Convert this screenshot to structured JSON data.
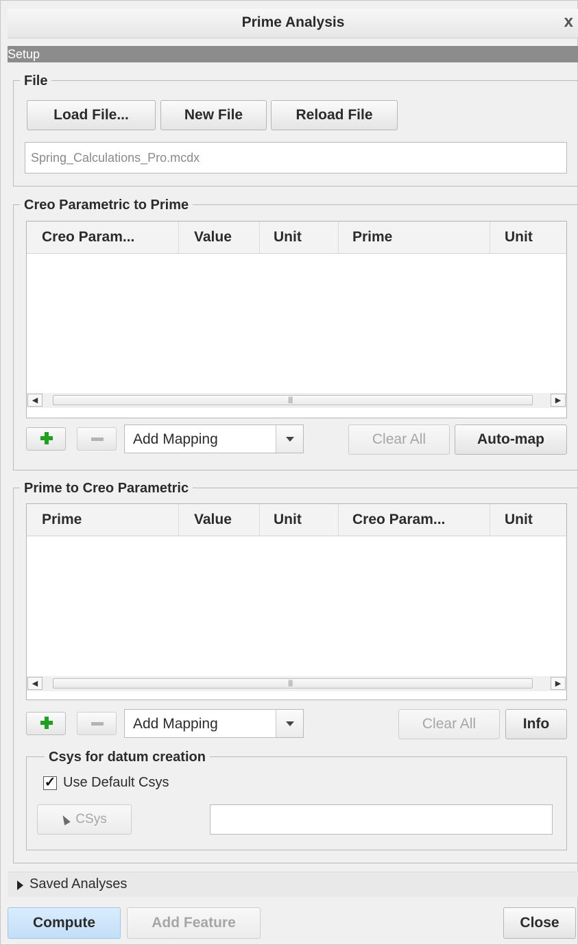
{
  "window": {
    "title": "Prime Analysis",
    "close_glyph": "x"
  },
  "setup": {
    "label": "Setup"
  },
  "file_group": {
    "legend": "File",
    "load_label": "Load File...",
    "new_label": "New File",
    "reload_label": "Reload File",
    "filename": "Spring_Calculations_Pro.mcdx"
  },
  "creo_to_prime": {
    "legend": "Creo Parametric to Prime",
    "columns": [
      "Creo Param...",
      "Value",
      "Unit",
      "Prime",
      "Unit"
    ],
    "rows": [],
    "mapping_value": "Add Mapping",
    "clear_label": "Clear All",
    "automap_label": "Auto-map"
  },
  "prime_to_creo": {
    "legend": "Prime to Creo Parametric",
    "columns": [
      "Prime",
      "Value",
      "Unit",
      "Creo Param...",
      "Unit"
    ],
    "rows": [],
    "mapping_value": "Add Mapping",
    "clear_label": "Clear All",
    "info_label": "Info"
  },
  "csys_group": {
    "legend": "Csys for datum creation",
    "use_default_label": "Use Default Csys",
    "use_default_checked": true,
    "csys_button_label": "CSys",
    "csys_value": ""
  },
  "saved_analyses": {
    "label": "Saved Analyses"
  },
  "footer": {
    "compute_label": "Compute",
    "add_feature_label": "Add Feature",
    "close_label": "Close"
  },
  "colors": {
    "compute_bg": "#cfe6fb",
    "setup_bar": "#8c8c8c",
    "plus_green": "#1fa11f"
  },
  "icons": [
    "close-icon",
    "plus-icon",
    "minus-icon",
    "dropdown-arrow-icon",
    "scroll-left-icon",
    "scroll-right-icon",
    "checkmark-icon",
    "cursor-arrow-icon",
    "expand-triangle-icon"
  ]
}
